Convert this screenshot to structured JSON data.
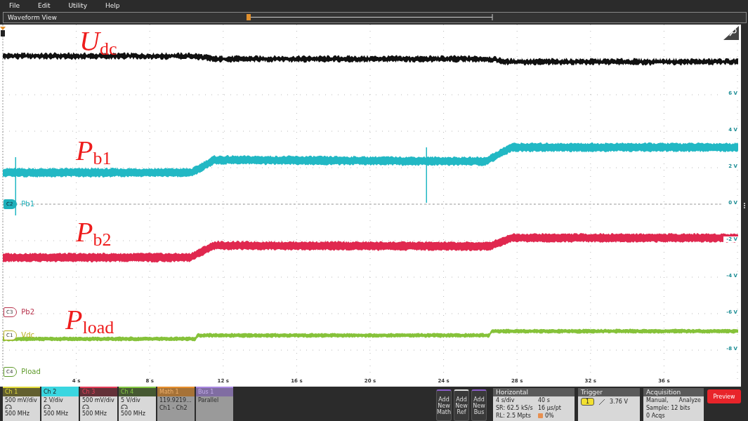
{
  "menu": [
    "File",
    "Edit",
    "Utility",
    "Help"
  ],
  "window": {
    "title": "Waveform View"
  },
  "plot": {
    "traces": [
      {
        "label": "*U*$_{dc}$",
        "color": "#111111"
      },
      {
        "label": "*P*$_{b1}$",
        "color": "#22b8c4"
      },
      {
        "label": "*P*$_{b2}$",
        "color": "#e0284f"
      },
      {
        "label": "*P*$_{load}$",
        "color": "#86c23a"
      }
    ],
    "markers": [
      {
        "badge": "C2",
        "label": "Pb1",
        "color": "#1fb0bb",
        "selected": true
      },
      {
        "badge": "C3",
        "label": "Pb2",
        "color": "#b8324c",
        "selected": false
      },
      {
        "badge": "C1",
        "label": "Vdc",
        "color": "#b8b020",
        "selected": false
      },
      {
        "badge": "C4",
        "label": "Pload",
        "color": "#5e9a2a",
        "selected": false
      }
    ],
    "y_ticks": [
      "6 V",
      "4 V",
      "2 V",
      "0 V",
      "-2 V",
      "-4 V",
      "-6 V",
      "-8 V"
    ],
    "x_ticks": [
      "4 s",
      "8 s",
      "12 s",
      "16 s",
      "20 s",
      "24 s",
      "28 s",
      "32 s",
      "36 s"
    ]
  },
  "channels": [
    {
      "title": "Ch 1",
      "kind": "channel",
      "color": "#e4dc3c",
      "selected": false,
      "disabled": false,
      "lines": [
        "500 mV/div",
        "500 MHz"
      ]
    },
    {
      "title": "Ch 2",
      "kind": "channel",
      "color": "#3ad6e0",
      "selected": true,
      "disabled": false,
      "lines": [
        "2 V/div",
        "500 MHz"
      ]
    },
    {
      "title": "Ch 3",
      "kind": "channel",
      "color": "#e8405a",
      "selected": false,
      "disabled": false,
      "lines": [
        "500 mV/div",
        "500 MHz"
      ]
    },
    {
      "title": "Ch 4",
      "kind": "channel",
      "color": "#86c844",
      "selected": false,
      "disabled": false,
      "lines": [
        "5 V/div",
        "500 MHz"
      ]
    },
    {
      "title": "Math 1",
      "kind": "math",
      "color": "#e8902e",
      "selected": false,
      "disabled": true,
      "lines": [
        "119.9219...",
        "Ch1 - Ch2"
      ]
    },
    {
      "title": "Bus 1",
      "kind": "bus",
      "color": "#a888e0",
      "selected": false,
      "disabled": true,
      "lines": [
        "Parallel"
      ]
    }
  ],
  "add_buttons": [
    {
      "label": "Add New Math",
      "color": "#8a5cc8"
    },
    {
      "label": "Add New Ref",
      "color": "#dddddd"
    },
    {
      "label": "Add New Bus",
      "color": "#8a5cc8"
    }
  ],
  "horizontal": {
    "title": "Horizontal",
    "cells": [
      "4 s/div",
      "40 s",
      "SR: 62.5 kS/s",
      "16 µs/pt",
      "RL: 2.5 Mpts",
      "0%"
    ]
  },
  "trigger": {
    "title": "Trigger",
    "source": "1",
    "value": "3.76 V"
  },
  "acquisition": {
    "title": "Acquisition",
    "lines": [
      "Manual,",
      "Analyze",
      "Sample: 12 bits",
      "0 Acqs"
    ]
  },
  "preview": "Preview"
}
